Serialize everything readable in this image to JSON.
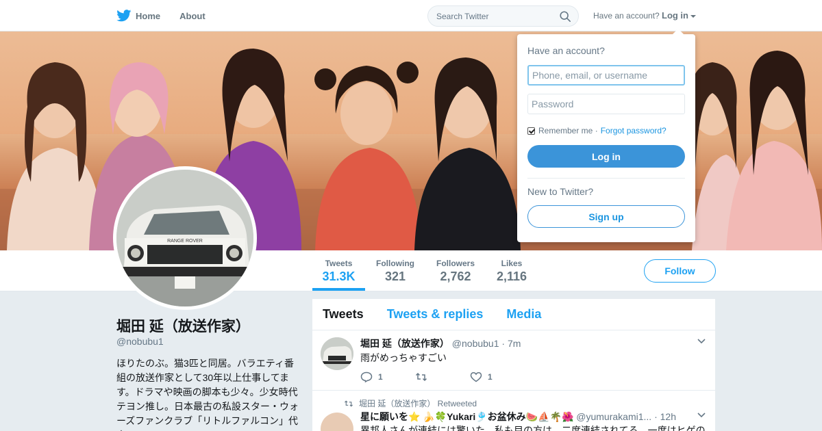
{
  "nav": {
    "home_label": "Home",
    "about_label": "About",
    "search_placeholder": "Search Twitter",
    "have_account": "Have an account?",
    "login_label": "Log in"
  },
  "profile": {
    "name": "堀田 延（放送作家）",
    "handle": "@nobubu1",
    "bio": "ほりたのぶ。猫3匹と同居。バラエティ番組の放送作家として30年以上仕事してます。ドラマや映画の脚本も少々。少女時代テヨン推し。日本最古の私設スター・ウォーズファンクラブ「リトルファルコン」代表。",
    "follow_label": "Follow",
    "avatar_plate": "RANGE ROVER"
  },
  "stats": [
    {
      "label": "Tweets",
      "value": "31.3K"
    },
    {
      "label": "Following",
      "value": "321"
    },
    {
      "label": "Followers",
      "value": "2,762"
    },
    {
      "label": "Likes",
      "value": "2,116"
    }
  ],
  "timeline": {
    "tabs": [
      "Tweets",
      "Tweets & replies",
      "Media"
    ],
    "tweets": [
      {
        "name": "堀田 延（放送作家）",
        "handle": "@nobubu1",
        "time": "· 7m",
        "text": "雨がめっちゃすごい",
        "reply_count": "1",
        "like_count": "1"
      },
      {
        "retweeted_by": "堀田 延（放送作家） Retweeted",
        "name": "星に願いを⭐ 🍌🍀Yukari🎐お盆休み🍉⛵🌴🌺",
        "handle": "@yumurakami1...",
        "time": "· 12h",
        "text": "異邦人さんが連結には驚いた。私も目の方は、二度連結されてる。一度はヒゲの"
      }
    ]
  },
  "login_dropdown": {
    "title": "Have an account?",
    "username_placeholder": "Phone, email, or username",
    "password_placeholder": "Password",
    "remember_label": "Remember me ·",
    "forgot_label": "Forgot password?",
    "login_button": "Log in",
    "new_to": "New to Twitter?",
    "signup_button": "Sign up"
  },
  "colors": {
    "accent": "#1da1f2",
    "login_button": "#3b94d9"
  },
  "icons": [
    "twitter-bird-icon",
    "search-icon",
    "chevron-down-icon",
    "reply-icon",
    "retweet-icon",
    "like-icon",
    "checkbox-icon"
  ]
}
